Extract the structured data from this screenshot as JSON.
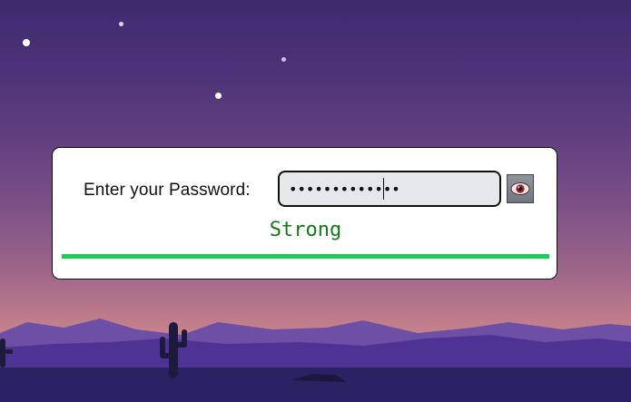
{
  "form": {
    "label": "Enter your Password:",
    "password_value": "•••••••••••••",
    "toggle_icon": "eye-icon"
  },
  "strength": {
    "text": "Strong",
    "level": 1.0,
    "bar_color": "#1fcc55",
    "text_color": "#137b18"
  }
}
